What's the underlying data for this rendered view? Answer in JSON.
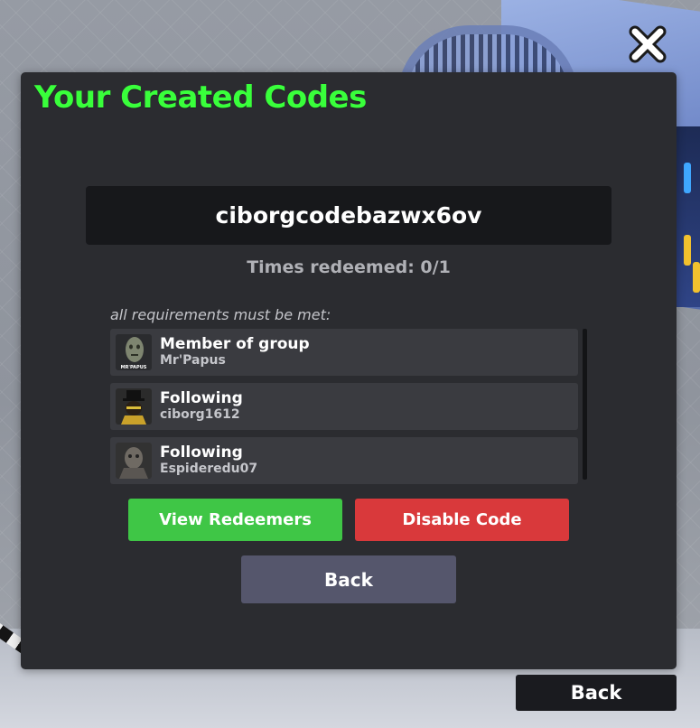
{
  "panel": {
    "title": "Your Created Codes",
    "code": "ciborgcodebazwx6ov",
    "times_redeemed": "Times redeemed: 0/1",
    "requirements_label": "all requirements must be met:",
    "requirements": [
      {
        "title": "Member of group",
        "subtitle": "Mr'Papus",
        "avatar_caption": "MR'PAPUS"
      },
      {
        "title": "Following",
        "subtitle": "ciborg1612"
      },
      {
        "title": "Following",
        "subtitle": "Espideredu07"
      }
    ],
    "view_redeemers_label": "View Redeemers",
    "disable_code_label": "Disable Code",
    "back_label": "Back"
  },
  "footer": {
    "back_label": "Back"
  },
  "icons": {
    "close": "close-icon"
  },
  "colors": {
    "title": "#39ff3b",
    "panel_bg": "#2b2c30",
    "view_button": "#3fc646",
    "disable_button": "#d9393b",
    "back_button": "#55566c",
    "outer_back_button": "#1a1b1f"
  }
}
